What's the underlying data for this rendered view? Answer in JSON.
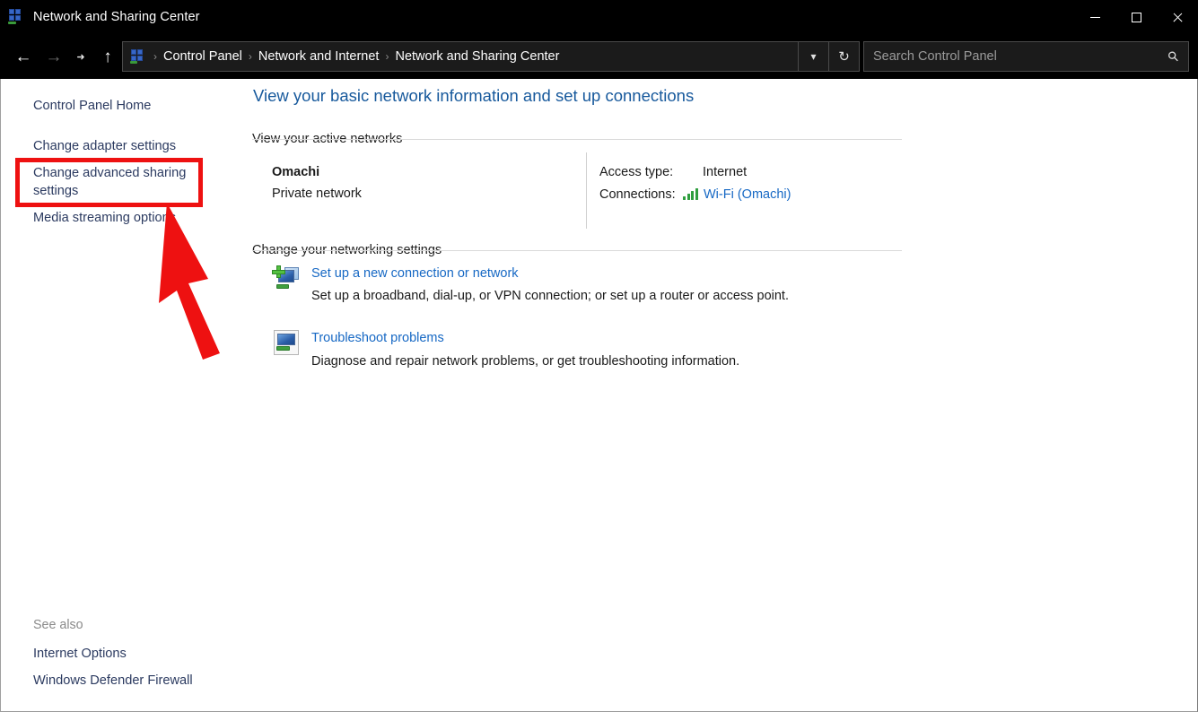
{
  "window": {
    "title": "Network and Sharing Center",
    "title_icon": "network-sharing-icon",
    "minimize_label": "Minimize",
    "maximize_label": "Maximize",
    "close_label": "Close"
  },
  "navbar": {
    "back_label": "Back",
    "forward_label": "Forward",
    "recent_label": "Recent locations",
    "up_label": "Up one level",
    "breadcrumb_icon": "network-sharing-icon",
    "separator": "›",
    "crumbs": [
      "Control Panel",
      "Network and Internet",
      "Network and Sharing Center"
    ],
    "previous_locations_icon": "chevron-down-icon",
    "refresh_icon": "refresh-icon"
  },
  "search": {
    "placeholder": "Search Control Panel",
    "icon": "search-icon"
  },
  "sidebar": {
    "home_link": "Control Panel Home",
    "links": [
      "Change adapter settings",
      "Change advanced sharing settings",
      "Media streaming options"
    ],
    "see_also_heading": "See also",
    "see_also": [
      "Internet Options",
      "Windows Defender Firewall"
    ]
  },
  "main": {
    "page_title": "View your basic network information and set up connections",
    "active_networks": {
      "heading": "View your active networks",
      "network_name": "Omachi",
      "network_type": "Private network",
      "access_type_label": "Access type:",
      "access_type_value": "Internet",
      "connections_label": "Connections:",
      "connections_icon": "wifi-signal-icon",
      "connections_value": "Wi-Fi (Omachi)"
    },
    "networking_settings": {
      "heading": "Change your networking settings",
      "items": [
        {
          "icon": "monitor-plus-icon",
          "link": "Set up a new connection or network",
          "description": "Set up a broadband, dial-up, or VPN connection; or set up a router or access point."
        },
        {
          "icon": "monitor-troubleshoot-icon",
          "link": "Troubleshoot problems",
          "description": "Diagnose and repair network problems, or get troubleshooting information."
        }
      ]
    }
  },
  "annotation": {
    "highlight_target": "Change advanced sharing settings",
    "highlight_color": "#ee1111",
    "arrow_color": "#ee1111"
  },
  "colors": {
    "titlebar_bg": "#000000",
    "page_bg": "#ffffff",
    "link_blue": "#1668c4",
    "heading_blue": "#17599c",
    "sidebar_link": "#2b3a60",
    "accent_green": "#2f9e3f"
  }
}
